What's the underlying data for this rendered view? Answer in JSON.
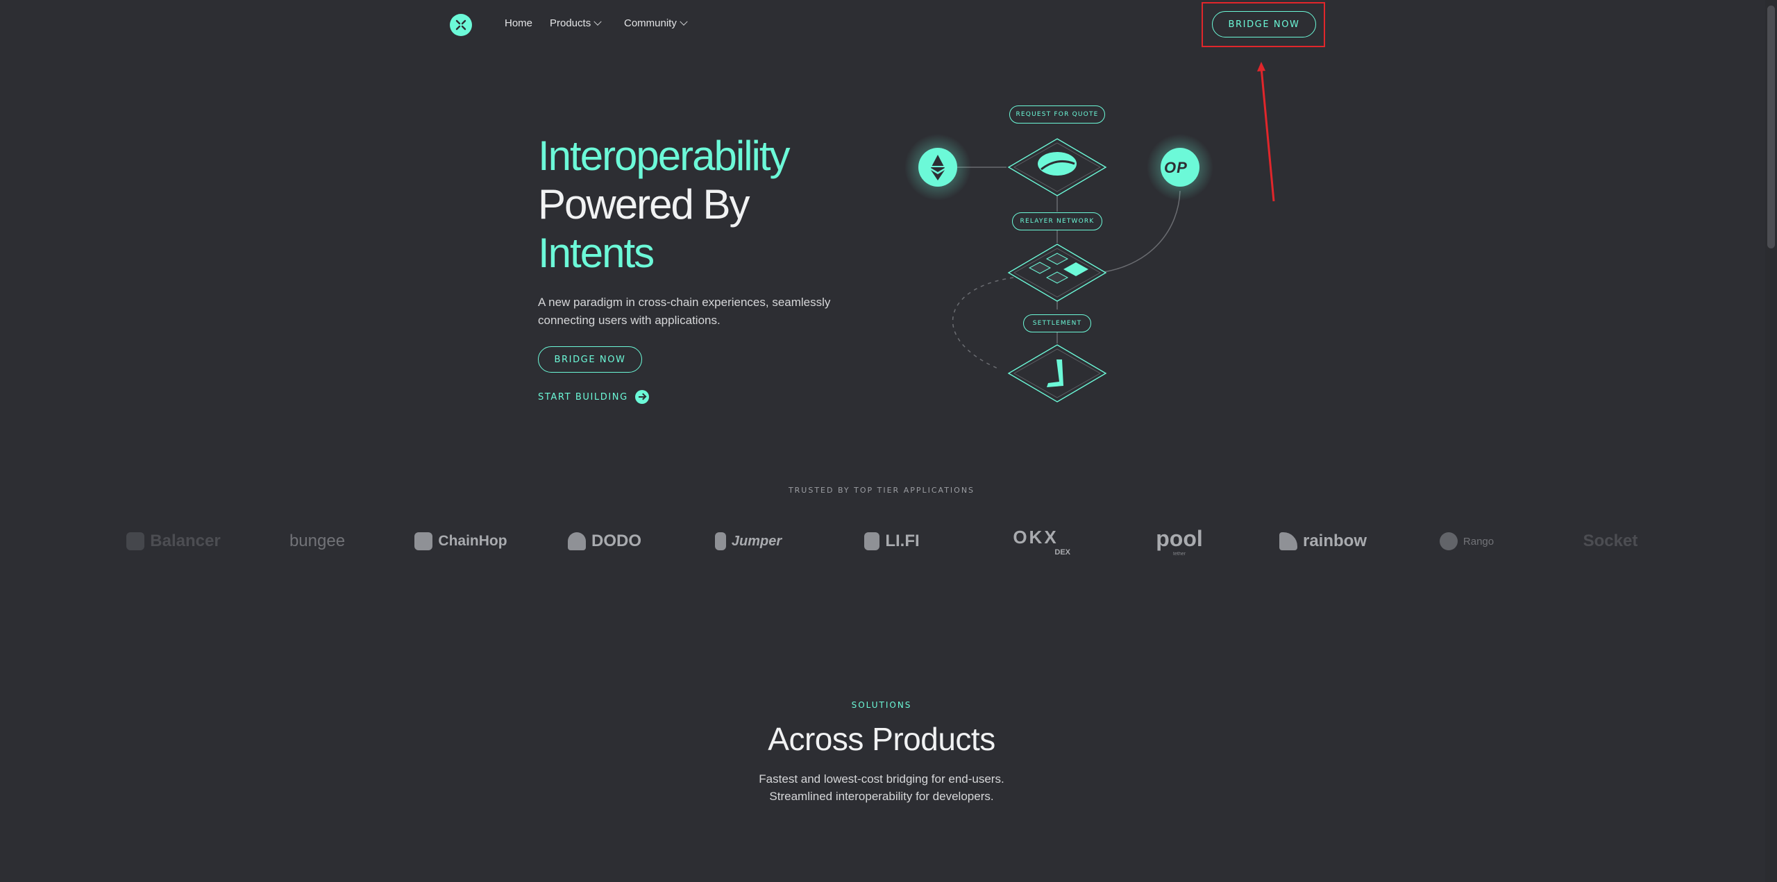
{
  "nav": {
    "home": "Home",
    "products": "Products",
    "community": "Community",
    "cta": "BRIDGE NOW"
  },
  "hero": {
    "title_line1": "Interoperability",
    "title_line2": "Powered By",
    "title_line3": "Intents",
    "subtitle": "A new paradigm in cross-chain experiences, seamlessly connecting users with applications.",
    "primary_button": "BRIDGE NOW",
    "secondary_link": "START BUILDING"
  },
  "diagram": {
    "pill_quote": "REQUEST FOR QUOTE",
    "pill_relayer": "RELAYER NETWORK",
    "pill_settlement": "SETTLEMENT",
    "op_label": "OP"
  },
  "trusted": {
    "heading": "TRUSTED BY TOP TIER APPLICATIONS",
    "logos": [
      "Balancer",
      "bungee",
      "ChainHop",
      "DODO",
      "Jumper",
      "LI.FI",
      "OKX",
      "pool",
      "rainbow",
      "Rango",
      "Socket"
    ],
    "okx_sub": "DEX",
    "pool_sub": "tether"
  },
  "solutions": {
    "kicker": "SOLUTIONS",
    "title": "Across Products",
    "line1": "Fastest and lowest-cost bridging for end-users.",
    "line2": "Streamlined interoperability for developers."
  },
  "colors": {
    "background": "#2d2e33",
    "accent": "#6cf9d8",
    "highlight": "#e0262b"
  }
}
